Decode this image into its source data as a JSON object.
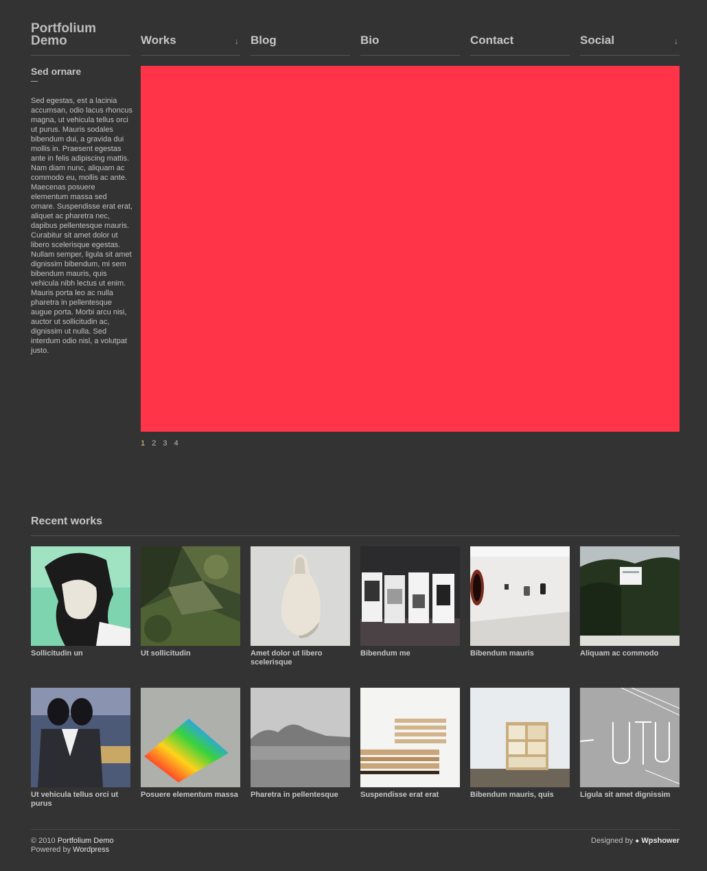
{
  "site": {
    "title": "Portfolium Demo"
  },
  "nav": [
    {
      "label": "Works",
      "has_submenu": true
    },
    {
      "label": "Blog",
      "has_submenu": false
    },
    {
      "label": "Bio",
      "has_submenu": false
    },
    {
      "label": "Contact",
      "has_submenu": false
    },
    {
      "label": "Social",
      "has_submenu": true
    }
  ],
  "sidebar": {
    "title": "Sed ornare",
    "text": "Sed egestas, est a lacinia accumsan, odio lacus rhoncus magna, ut vehicula tellus orci ut purus. Mauris sodales bibendum dui, a gravida dui mollis in. Praesent egestas ante in felis adipiscing mattis. Nam diam nunc, aliquam ac commodo eu, mollis ac ante. Maecenas posuere elementum massa sed ornare. Suspendisse erat erat, aliquet ac pharetra nec, dapibus pellentesque mauris. Curabitur sit amet dolor ut libero scelerisque egestas. Nullam semper, ligula sit amet dignissim bibendum, mi sem bibendum mauris, quis vehicula nibh lectus ut enim. Mauris porta leo ac nulla pharetra in pellentesque augue porta. Morbi arcu nisi, auctor ut sollicitudin ac, dignissim ut nulla. Sed interdum odio nisl, a volutpat justo."
  },
  "slider": {
    "color": "#ff3448",
    "pages": [
      "1",
      "2",
      "3",
      "4"
    ],
    "active_page": "1"
  },
  "recent": {
    "title": "Recent works",
    "items": [
      {
        "caption": "Sollicitudin un"
      },
      {
        "caption": "Ut sollicitudin"
      },
      {
        "caption": "Amet dolor ut libero scelerisque"
      },
      {
        "caption": "Bibendum me"
      },
      {
        "caption": "Bibendum mauris"
      },
      {
        "caption": "Aliquam ac commodo"
      },
      {
        "caption": "Ut vehicula tellus orci ut purus"
      },
      {
        "caption": "Posuere elementum massa"
      },
      {
        "caption": "Pharetra in pellentesque"
      },
      {
        "caption": "Suspendisse erat erat"
      },
      {
        "caption": "Bibendum mauris, quis"
      },
      {
        "caption": "Ligula sit amet dignissim"
      }
    ]
  },
  "footer": {
    "copyright": "© 2010",
    "site_link": "Portfolium Demo",
    "powered_prefix": "Powered by",
    "powered_link": "Wordpress",
    "designed_prefix": "Designed by",
    "designer_link": "Wpshower"
  }
}
